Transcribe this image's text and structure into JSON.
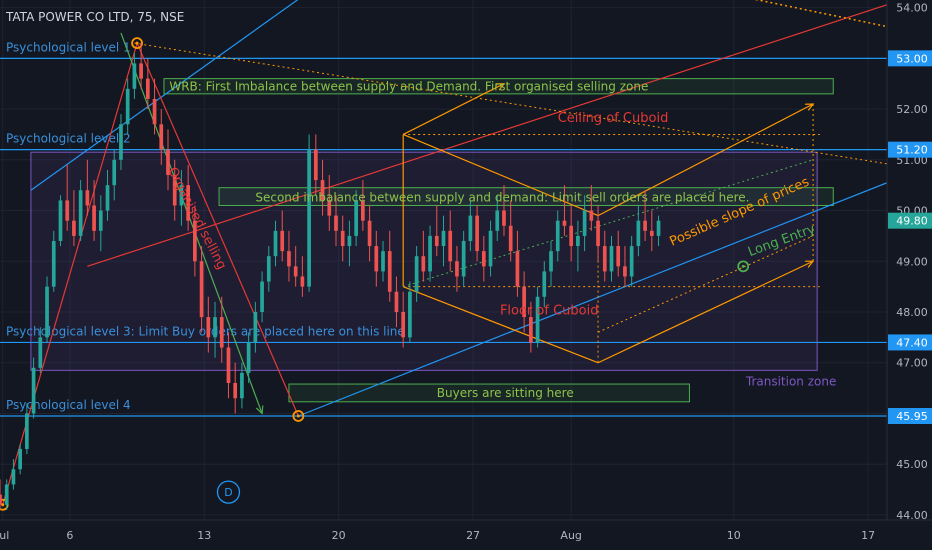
{
  "header": {
    "title": "TATA POWER CO LTD, 75, NSE"
  },
  "colors": {
    "background": "#131722",
    "grid": "#1e2330",
    "up": "#26a69a",
    "down": "#ef5350",
    "blue_line": "#2196f3",
    "label_blue": "#3a8fd9",
    "green_box": "#4caf50",
    "orange": "#ff9800",
    "red_line": "#e53935",
    "purple": "#7e57c2",
    "axis_text": "#b2b5be"
  },
  "chart_data": {
    "type": "candlestick",
    "title": "TATA POWER CO LTD, 75, NSE",
    "xlabel": "",
    "ylabel": "",
    "ylim": [
      43.9,
      54.15
    ],
    "x_range": [
      0,
      66
    ],
    "grid": true,
    "x_ticks": [
      {
        "label": "Jul",
        "x": 0.2
      },
      {
        "label": "6",
        "x": 5.2
      },
      {
        "label": "13",
        "x": 15.2
      },
      {
        "label": "20",
        "x": 25.2
      },
      {
        "label": "27",
        "x": 35.2
      },
      {
        "label": "Aug",
        "x": 42.5
      },
      {
        "label": "10",
        "x": 54.6
      },
      {
        "label": "17",
        "x": 64.6
      }
    ],
    "y_ticks": [
      44,
      45,
      46,
      47,
      48,
      49,
      50,
      51,
      52,
      53,
      54
    ],
    "price_levels": [
      {
        "label": "Psychological level 1",
        "value": 53.0,
        "axis_label": "53.00"
      },
      {
        "label": "Psychological level 2",
        "value": 51.2,
        "axis_label": "51.20"
      },
      {
        "label": "Psychological level 3: Limit Buy orders are placed here on this line",
        "value": 47.4,
        "axis_label": "47.40"
      },
      {
        "label": "Psychological level 4",
        "value": 45.95,
        "axis_label": "45.95"
      }
    ],
    "last_price": {
      "value": 49.8,
      "axis_label": "49.80"
    },
    "candles": [
      [
        0.0,
        44.4,
        44.7,
        44.1,
        44.2
      ],
      [
        0.5,
        44.2,
        44.7,
        44.1,
        44.6
      ],
      [
        1.0,
        44.6,
        45.1,
        44.5,
        44.9
      ],
      [
        1.5,
        44.9,
        45.4,
        44.8,
        45.3
      ],
      [
        2.0,
        45.3,
        46.2,
        45.2,
        46.0
      ],
      [
        2.5,
        46.0,
        47.1,
        45.9,
        46.9
      ],
      [
        3.0,
        46.9,
        47.7,
        46.8,
        47.5
      ],
      [
        3.5,
        47.5,
        48.7,
        47.4,
        48.5
      ],
      [
        4.0,
        48.5,
        49.6,
        48.4,
        49.4
      ],
      [
        4.5,
        49.4,
        50.3,
        49.3,
        50.2
      ],
      [
        5.0,
        50.2,
        50.9,
        49.6,
        49.8
      ],
      [
        5.5,
        49.8,
        50.4,
        49.3,
        49.5
      ],
      [
        6.0,
        49.5,
        50.6,
        49.4,
        50.4
      ],
      [
        6.5,
        50.4,
        51.0,
        49.9,
        50.1
      ],
      [
        7.0,
        50.1,
        50.6,
        49.4,
        49.6
      ],
      [
        7.5,
        49.6,
        50.3,
        49.2,
        50.0
      ],
      [
        8.0,
        50.0,
        50.8,
        49.8,
        50.5
      ],
      [
        8.5,
        50.5,
        51.2,
        50.2,
        51.0
      ],
      [
        9.0,
        51.0,
        51.9,
        50.8,
        51.7
      ],
      [
        9.5,
        51.7,
        52.6,
        51.5,
        52.4
      ],
      [
        10.0,
        52.4,
        53.1,
        52.2,
        52.9
      ],
      [
        10.5,
        52.9,
        53.3,
        52.4,
        52.6
      ],
      [
        11.0,
        52.6,
        53.0,
        52.0,
        52.2
      ],
      [
        11.5,
        52.2,
        52.6,
        51.5,
        51.7
      ],
      [
        12.0,
        51.7,
        52.0,
        50.9,
        51.2
      ],
      [
        12.5,
        51.2,
        51.6,
        50.4,
        50.7
      ],
      [
        13.0,
        50.7,
        51.0,
        49.8,
        50.1
      ],
      [
        13.5,
        50.1,
        50.8,
        49.7,
        50.5
      ],
      [
        14.0,
        50.5,
        50.9,
        49.6,
        49.8
      ],
      [
        14.5,
        49.8,
        50.1,
        48.7,
        49.0
      ],
      [
        15.0,
        49.0,
        49.3,
        47.6,
        47.9
      ],
      [
        15.5,
        47.9,
        48.3,
        47.2,
        47.5
      ],
      [
        16.0,
        47.5,
        48.2,
        47.1,
        47.9
      ],
      [
        16.5,
        47.9,
        48.3,
        47.0,
        47.3
      ],
      [
        17.0,
        47.3,
        47.6,
        46.3,
        46.6
      ],
      [
        17.5,
        46.6,
        47.0,
        46.0,
        46.3
      ],
      [
        18.0,
        46.3,
        47.0,
        46.1,
        46.8
      ],
      [
        18.5,
        46.8,
        47.6,
        46.6,
        47.4
      ],
      [
        19.0,
        47.4,
        48.2,
        47.2,
        48.0
      ],
      [
        19.5,
        48.0,
        48.8,
        47.8,
        48.6
      ],
      [
        20.0,
        48.6,
        49.3,
        48.4,
        49.1
      ],
      [
        20.5,
        49.1,
        49.8,
        48.9,
        49.6
      ],
      [
        21.0,
        49.6,
        50.0,
        49.0,
        49.2
      ],
      [
        21.5,
        49.2,
        49.6,
        48.6,
        48.9
      ],
      [
        22.0,
        48.9,
        49.3,
        48.5,
        48.7
      ],
      [
        22.5,
        48.7,
        49.1,
        48.3,
        48.5
      ],
      [
        23.0,
        48.5,
        51.5,
        48.4,
        51.2
      ],
      [
        23.5,
        51.2,
        51.5,
        50.3,
        50.6
      ],
      [
        24.0,
        50.6,
        51.0,
        49.9,
        50.2
      ],
      [
        24.5,
        50.2,
        50.7,
        49.6,
        49.9
      ],
      [
        25.0,
        49.9,
        50.3,
        49.3,
        49.6
      ],
      [
        25.5,
        49.6,
        49.9,
        49.0,
        49.3
      ],
      [
        26.0,
        49.3,
        49.8,
        48.9,
        49.5
      ],
      [
        26.5,
        49.5,
        50.4,
        49.3,
        50.2
      ],
      [
        27.0,
        50.2,
        50.6,
        49.6,
        49.8
      ],
      [
        27.5,
        49.8,
        50.1,
        49.0,
        49.3
      ],
      [
        28.0,
        49.3,
        49.6,
        48.5,
        48.8
      ],
      [
        28.5,
        48.8,
        49.4,
        48.6,
        49.2
      ],
      [
        29.0,
        49.2,
        49.6,
        48.2,
        48.4
      ],
      [
        29.5,
        48.4,
        48.7,
        47.7,
        48.0
      ],
      [
        30.0,
        48.0,
        48.4,
        47.3,
        47.5
      ],
      [
        30.5,
        47.5,
        48.6,
        47.4,
        48.4
      ],
      [
        31.0,
        48.4,
        49.3,
        48.2,
        49.1
      ],
      [
        31.5,
        49.1,
        49.6,
        48.6,
        48.8
      ],
      [
        32.0,
        48.8,
        49.7,
        48.6,
        49.5
      ],
      [
        32.5,
        49.5,
        50.1,
        49.1,
        49.3
      ],
      [
        33.0,
        49.3,
        49.9,
        48.9,
        49.6
      ],
      [
        33.5,
        49.6,
        50.0,
        48.8,
        49.0
      ],
      [
        34.0,
        49.0,
        49.3,
        48.4,
        48.7
      ],
      [
        34.5,
        48.7,
        49.6,
        48.5,
        49.4
      ],
      [
        35.0,
        49.4,
        50.2,
        49.2,
        49.9
      ],
      [
        35.5,
        49.9,
        50.1,
        49.0,
        49.2
      ],
      [
        36.0,
        49.2,
        49.5,
        48.6,
        48.9
      ],
      [
        36.5,
        48.9,
        49.8,
        48.7,
        49.6
      ],
      [
        37.0,
        49.6,
        50.3,
        49.4,
        50.0
      ],
      [
        37.5,
        50.0,
        50.5,
        49.5,
        49.7
      ],
      [
        38.0,
        49.7,
        50.2,
        49.0,
        49.2
      ],
      [
        38.5,
        49.2,
        49.6,
        48.3,
        48.5
      ],
      [
        39.0,
        48.5,
        48.8,
        47.6,
        47.9
      ],
      [
        39.5,
        47.9,
        48.2,
        47.2,
        47.4
      ],
      [
        40.0,
        47.4,
        48.5,
        47.3,
        48.3
      ],
      [
        40.5,
        48.3,
        49.0,
        48.1,
        48.8
      ],
      [
        41.0,
        48.8,
        49.4,
        48.5,
        49.2
      ],
      [
        41.5,
        49.2,
        50.0,
        49.0,
        49.8
      ],
      [
        42.0,
        49.8,
        50.5,
        49.5,
        49.7
      ],
      [
        42.5,
        49.7,
        50.1,
        49.0,
        49.3
      ],
      [
        43.0,
        49.3,
        49.8,
        48.8,
        49.5
      ],
      [
        43.5,
        49.5,
        50.3,
        49.2,
        50.0
      ],
      [
        44.0,
        50.0,
        50.5,
        49.6,
        49.8
      ],
      [
        44.5,
        49.8,
        50.1,
        49.0,
        49.3
      ],
      [
        45.0,
        49.3,
        49.6,
        48.6,
        48.8
      ],
      [
        45.5,
        48.8,
        49.5,
        48.6,
        49.3
      ],
      [
        46.0,
        49.3,
        49.6,
        48.7,
        48.9
      ],
      [
        46.5,
        48.9,
        49.3,
        48.5,
        48.7
      ],
      [
        47.0,
        48.7,
        49.5,
        48.5,
        49.3
      ],
      [
        47.5,
        49.3,
        50.1,
        49.1,
        49.8
      ],
      [
        48.0,
        49.8,
        50.4,
        49.4,
        49.6
      ],
      [
        48.5,
        49.6,
        50.0,
        49.2,
        49.5
      ],
      [
        49.0,
        49.5,
        49.9,
        49.3,
        49.8
      ]
    ],
    "markers": [
      {
        "label": "D",
        "x": 17.0,
        "y": 44.45
      }
    ],
    "annotations": [
      {
        "name": "wrb-zone",
        "text": "WRB: First Imbalance between supply and Demand. First organised selling zone"
      },
      {
        "name": "second-imbalance-zone",
        "text": "Second imbalance between supply and demand: Limit sell orders are placed here."
      },
      {
        "name": "buyers-zone",
        "text": "Buyers are sitting here"
      },
      {
        "name": "transition-zone",
        "text": "Transition zone"
      },
      {
        "name": "ceiling-label",
        "text": "Ceiling of Cuboid"
      },
      {
        "name": "floor-label",
        "text": "Floor of Cuboid"
      },
      {
        "name": "organised-selling-label",
        "text": "Organised selling"
      },
      {
        "name": "slope-label",
        "text": "Possible slope of prices"
      },
      {
        "name": "long-entry-label",
        "text": "Long Entry"
      }
    ]
  }
}
